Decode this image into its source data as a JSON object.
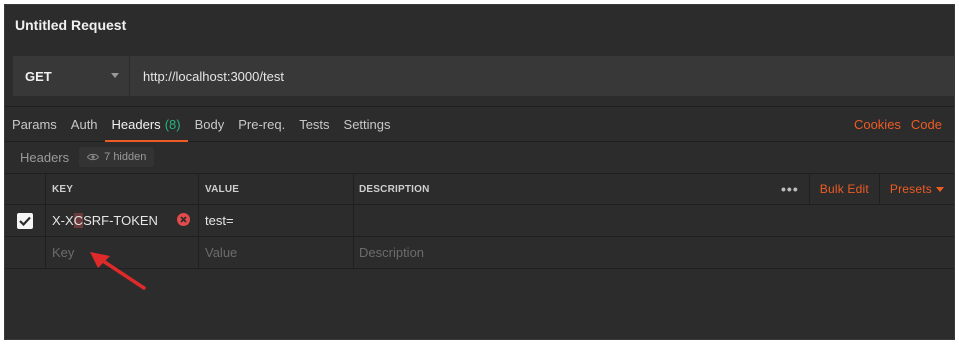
{
  "title": "Untitled Request",
  "request": {
    "method": "GET",
    "url": "http://localhost:3000/test"
  },
  "tabs": [
    {
      "label": "Params"
    },
    {
      "label": "Auth"
    },
    {
      "label": "Headers",
      "count": "(8)"
    },
    {
      "label": "Body"
    },
    {
      "label": "Pre-req."
    },
    {
      "label": "Tests"
    },
    {
      "label": "Settings"
    }
  ],
  "tab_links": {
    "cookies": "Cookies",
    "code": "Code"
  },
  "subhead": {
    "label": "Headers",
    "hidden": "7 hidden"
  },
  "table": {
    "columns": {
      "key": "KEY",
      "value": "VALUE",
      "description": "DESCRIPTION"
    },
    "actions": {
      "more": "•••",
      "bulk_edit": "Bulk Edit",
      "presets": "Presets"
    },
    "rows": [
      {
        "checked": true,
        "key_prefix": "X-X",
        "key_cursor": "C",
        "key_suffix": "SRF-TOKEN",
        "value": "test=",
        "description": ""
      }
    ],
    "placeholders": {
      "key": "Key",
      "value": "Value",
      "description": "Description"
    }
  },
  "colors": {
    "accent": "#ef5b25",
    "count": "#26b47f",
    "background": "#2c2c2c",
    "remove": "#e34b4b",
    "arrow": "#e02a2a"
  }
}
